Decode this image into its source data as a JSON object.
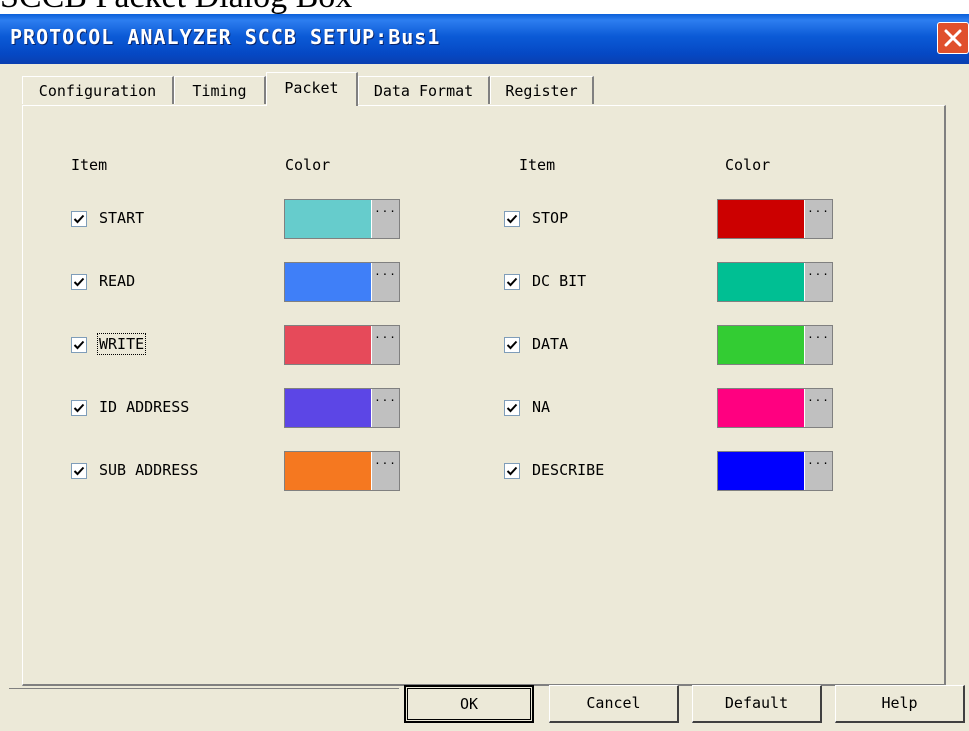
{
  "clipped_caption": "SCCB Packet Dialog Box",
  "window": {
    "title": "PROTOCOL ANALYZER SCCB SETUP:Bus1"
  },
  "tabs": [
    {
      "label": "Configuration"
    },
    {
      "label": "Timing"
    },
    {
      "label": "Packet"
    },
    {
      "label": "Data Format"
    },
    {
      "label": "Register"
    }
  ],
  "headers": {
    "left_item": "Item",
    "left_color": "Color",
    "right_item": "Item",
    "right_color": "Color"
  },
  "left_items": [
    {
      "label": "START",
      "checked": true,
      "color": "#66cccc"
    },
    {
      "label": "READ",
      "checked": true,
      "color": "#3f7ff8"
    },
    {
      "label": "WRITE",
      "checked": true,
      "color": "#e64a5a"
    },
    {
      "label": "ID ADDRESS",
      "checked": true,
      "color": "#5c46e6"
    },
    {
      "label": "SUB ADDRESS",
      "checked": true,
      "color": "#f57820"
    }
  ],
  "right_items": [
    {
      "label": "STOP",
      "checked": true,
      "color": "#cc0000"
    },
    {
      "label": "DC BIT",
      "checked": true,
      "color": "#00bf93"
    },
    {
      "label": "DATA",
      "checked": true,
      "color": "#33cc33"
    },
    {
      "label": "NA",
      "checked": true,
      "color": "#ff0080"
    },
    {
      "label": "DESCRIBE",
      "checked": true,
      "color": "#0000ff"
    }
  ],
  "swatch_button_text": "···",
  "buttons": {
    "ok": "OK",
    "cancel": "Cancel",
    "default": "Default",
    "help": "Help"
  }
}
